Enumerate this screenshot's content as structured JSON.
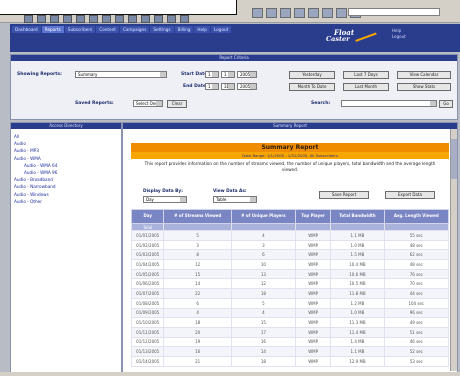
{
  "header": {
    "nav": [
      "Dashboard",
      "Reports",
      "Subscribers",
      "Content",
      "Campaigns",
      "Settings",
      "Billing",
      "Help",
      "Logout"
    ],
    "logo_line1": "Float",
    "logo_line2": "Caster",
    "right_line1": "Help",
    "right_line2": "Logout"
  },
  "criteria": {
    "bar_title": "Report Criteria",
    "showing_label": "Showing Reports:",
    "showing_value": "Summary",
    "start_label": "Start Date:",
    "start_m": "1",
    "start_d": "1",
    "start_y": "2005",
    "end_label": "End Date:",
    "end_m": "1",
    "end_d": "31",
    "end_y": "2005",
    "btn_yesterday": "Yesterday",
    "btn_last7": "Last 7 Days",
    "btn_view_calendar": "View Calendar",
    "btn_month_to_date": "Month To Date",
    "btn_last_month": "Last Month",
    "btn_show_stats": "Show Stats",
    "saved_label": "Saved Reports:",
    "saved_value": "Select One",
    "btn_clear": "Clear",
    "search_label": "Search:",
    "btn_go": "Go"
  },
  "left": {
    "bar_title": "Access Directory",
    "items": [
      {
        "label": "All",
        "indent": 0
      },
      {
        "label": "Audio",
        "indent": 0
      },
      {
        "label": "Audio - MP3",
        "indent": 0
      },
      {
        "label": "Audio - WMA",
        "indent": 0
      },
      {
        "label": "Audio - WMA 64",
        "indent": 2
      },
      {
        "label": "Audio - WMA 96",
        "indent": 2
      },
      {
        "label": "Audio - Broadband",
        "indent": 0
      },
      {
        "label": "Audio - Narrowband",
        "indent": 0
      },
      {
        "label": "Audio - Windows",
        "indent": 0
      },
      {
        "label": "Audio - Other",
        "indent": 0
      }
    ]
  },
  "right": {
    "bar_title": "Summary Report",
    "title": "Summary Report",
    "subtitle": "Date Range: 1/1/2005 - 1/31/2005, All Subscribers",
    "description": "This report provides information on the number of streams viewed, the number of unique players, total bandwidth and the average length viewed.",
    "display_by_label": "Display Data By:",
    "display_by_value": "Day",
    "view_label": "View Data As:",
    "view_value": "Table",
    "btn_save": "Save Report",
    "btn_export": "Export Data",
    "columns": [
      "Day",
      "# of Streams Viewed",
      "# of Unique Players",
      "Top Player",
      "Total Bandwidth",
      "Avg. Length Viewed"
    ],
    "totals": [
      "Total",
      "",
      "",
      "",
      "",
      ""
    ],
    "rows": [
      [
        "01/01/2005",
        "5",
        "4",
        "WMP",
        "1.1 MB",
        "55 sec"
      ],
      [
        "01/02/2005",
        "3",
        "3",
        "WMP",
        "1.0 MB",
        "48 sec"
      ],
      [
        "01/03/2005",
        "8",
        "6",
        "WMP",
        "1.5 MB",
        "62 sec"
      ],
      [
        "01/04/2005",
        "12",
        "10",
        "WMP",
        "10.4 MB",
        "48 sec"
      ],
      [
        "01/05/2005",
        "15",
        "13",
        "WMP",
        "10.6 MB",
        "76 sec"
      ],
      [
        "01/06/2005",
        "14",
        "12",
        "WMP",
        "10.5 MB",
        "70 sec"
      ],
      [
        "01/07/2005",
        "22",
        "18",
        "WMP",
        "11.8 MB",
        "44 sec"
      ],
      [
        "01/08/2005",
        "6",
        "5",
        "WMP",
        "1.2 MB",
        "104 sec"
      ],
      [
        "01/09/2005",
        "4",
        "4",
        "WMP",
        "1.0 MB",
        "96 sec"
      ],
      [
        "01/10/2005",
        "18",
        "15",
        "WMP",
        "11.3 MB",
        "49 sec"
      ],
      [
        "01/11/2005",
        "20",
        "17",
        "WMP",
        "11.4 MB",
        "51 sec"
      ],
      [
        "01/12/2005",
        "19",
        "16",
        "WMP",
        "1.4 MB",
        "46 sec"
      ],
      [
        "01/13/2005",
        "16",
        "14",
        "WMP",
        "1.1 MB",
        "52 sec"
      ],
      [
        "01/14/2005",
        "21",
        "18",
        "WMP",
        "12.9 MB",
        "53 sec"
      ]
    ]
  }
}
